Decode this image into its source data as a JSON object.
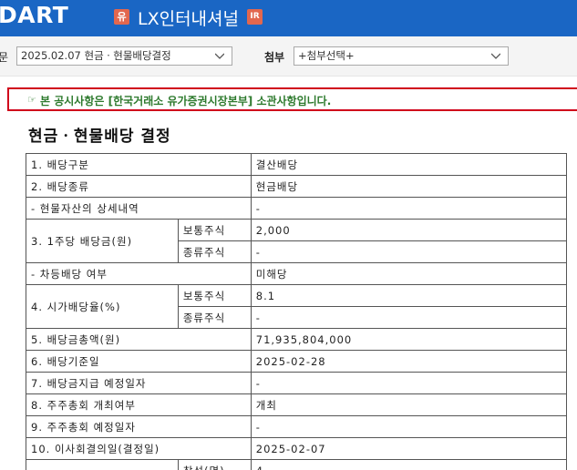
{
  "header": {
    "logo": "DART",
    "badge_yu": "유",
    "company": "LX인터내셔널",
    "badge_ir": "IR"
  },
  "toolbar": {
    "label_1": "문",
    "select_1": "2025.02.07  현금ㆍ현물배당결정",
    "label_2": "첨부",
    "select_2": "+첨부선택+"
  },
  "notice": {
    "icon": "☞",
    "text": "본 공시사항은 [한국거래소 유가증권시장본부] 소관사항입니다."
  },
  "doc": {
    "title": "현금ㆍ현물배당 결정",
    "rows": {
      "r1": {
        "label": "1. 배당구분",
        "value": "결산배당"
      },
      "r2": {
        "label": "2. 배당종류",
        "value": "현금배당"
      },
      "r3": {
        "label": "- 현물자산의 상세내역",
        "value": "-"
      },
      "r4": {
        "label": "3. 1주당 배당금(원)",
        "sub1": "보통주식",
        "val1": "2,000",
        "sub2": "종류주식",
        "val2": "-"
      },
      "r5": {
        "label": "- 차등배당 여부",
        "value": "미해당"
      },
      "r6": {
        "label": "4. 시가배당율(%)",
        "sub1": "보통주식",
        "val1": "8.1",
        "sub2": "종류주식",
        "val2": "-"
      },
      "r7": {
        "label": "5. 배당금총액(원)",
        "value": "71,935,804,000"
      },
      "r8": {
        "label": "6. 배당기준일",
        "value": "2025-02-28"
      },
      "r9": {
        "label": "7. 배당금지급 예정일자",
        "value": "-"
      },
      "r10": {
        "label": "8. 주주총회 개최여부",
        "value": "개최"
      },
      "r11": {
        "label": "9. 주주총회 예정일자",
        "value": "-"
      },
      "r12": {
        "label": "10. 이사회결의일(결정일)",
        "value": "2025-02-07"
      },
      "r13": {
        "sub1": "참석(명)",
        "val1": "4"
      }
    }
  }
}
